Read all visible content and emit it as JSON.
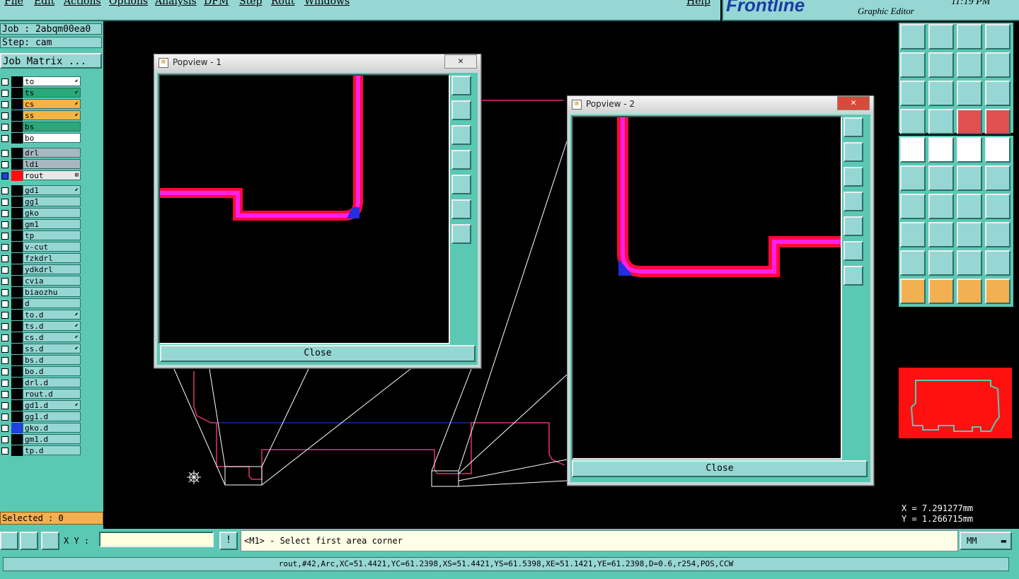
{
  "menu": [
    "File",
    "Edit",
    "Actions",
    "Options",
    "Analysis",
    "DFM",
    "Step",
    "Rout",
    "Windows"
  ],
  "help_label": "Help",
  "brand": "Frontline",
  "editor_title": "Graphic Editor",
  "clock": "11:19 PM",
  "job_label": "Job : 2abqm00ea0",
  "step_label": "Step: cam",
  "job_matrix_label": "Job Matrix ...",
  "layers": [
    {
      "name": "to",
      "color": "#ffffff",
      "mark": "⬋"
    },
    {
      "name": "ts",
      "color": "#2aa87a",
      "mark": "⬋"
    },
    {
      "name": "cs",
      "color": "#f5b442",
      "mark": "⬋"
    },
    {
      "name": "ss",
      "color": "#f5b442",
      "mark": "⬋"
    },
    {
      "name": "bs",
      "color": "#2aa87a",
      "mark": ""
    },
    {
      "name": "bo",
      "color": "#ffffff",
      "mark": ""
    },
    {
      "name": "drl",
      "color": "#a8b8c0",
      "mark": ""
    },
    {
      "name": "ldi",
      "color": "#a8b8c0",
      "mark": ""
    },
    {
      "name": "rout",
      "color": "#e8e8e8",
      "mark": "⊞"
    },
    {
      "name": "gd1",
      "color": "#96d7d4",
      "mark": "⬋"
    },
    {
      "name": "gg1",
      "color": "#96d7d4",
      "mark": ""
    },
    {
      "name": "gko",
      "color": "#96d7d4",
      "mark": ""
    },
    {
      "name": "gm1",
      "color": "#96d7d4",
      "mark": ""
    },
    {
      "name": "tp",
      "color": "#96d7d4",
      "mark": ""
    },
    {
      "name": "v-cut",
      "color": "#96d7d4",
      "mark": ""
    },
    {
      "name": "fzkdrl",
      "color": "#96d7d4",
      "mark": ""
    },
    {
      "name": "ydkdrl",
      "color": "#96d7d4",
      "mark": ""
    },
    {
      "name": "cvia",
      "color": "#96d7d4",
      "mark": ""
    },
    {
      "name": "biaozhu",
      "color": "#96d7d4",
      "mark": ""
    },
    {
      "name": "d",
      "color": "#96d7d4",
      "mark": ""
    },
    {
      "name": "to.d",
      "color": "#96d7d4",
      "mark": "⬋"
    },
    {
      "name": "ts.d",
      "color": "#96d7d4",
      "mark": "⬋"
    },
    {
      "name": "cs.d",
      "color": "#96d7d4",
      "mark": "⬋"
    },
    {
      "name": "ss.d",
      "color": "#96d7d4",
      "mark": "⬋"
    },
    {
      "name": "bs.d",
      "color": "#96d7d4",
      "mark": ""
    },
    {
      "name": "bo.d",
      "color": "#96d7d4",
      "mark": ""
    },
    {
      "name": "drl.d",
      "color": "#96d7d4",
      "mark": ""
    },
    {
      "name": "rout.d",
      "color": "#96d7d4",
      "mark": ""
    },
    {
      "name": "gd1.d",
      "color": "#96d7d4",
      "mark": "⬋"
    },
    {
      "name": "gg1.d",
      "color": "#96d7d4",
      "mark": ""
    },
    {
      "name": "gko.d",
      "color": "#96d7d4",
      "mark": ""
    },
    {
      "name": "gm1.d",
      "color": "#96d7d4",
      "mark": ""
    },
    {
      "name": "tp.d",
      "color": "#96d7d4",
      "mark": ""
    }
  ],
  "selected_label": "Selected : 0",
  "popview1": {
    "title": "Popview - 1",
    "close_label": "Close",
    "x_label": "✕"
  },
  "popview2": {
    "title": "Popview - 2",
    "close_label": "Close",
    "x_label": "✕"
  },
  "coords": {
    "x": "X = 7.291277mm",
    "y": "Y = 1.266715mm"
  },
  "xy_label": "X Y :",
  "xy_value": "",
  "prompt_text": "<M1> - Select first area corner",
  "units": "MM",
  "status_text": "rout,#42,Arc,XC=51.4421,YC=61.2398,XS=51.4421,YS=61.5398,XE=51.1421,YE=61.2398,D=0.6,r254,POS,CCW"
}
